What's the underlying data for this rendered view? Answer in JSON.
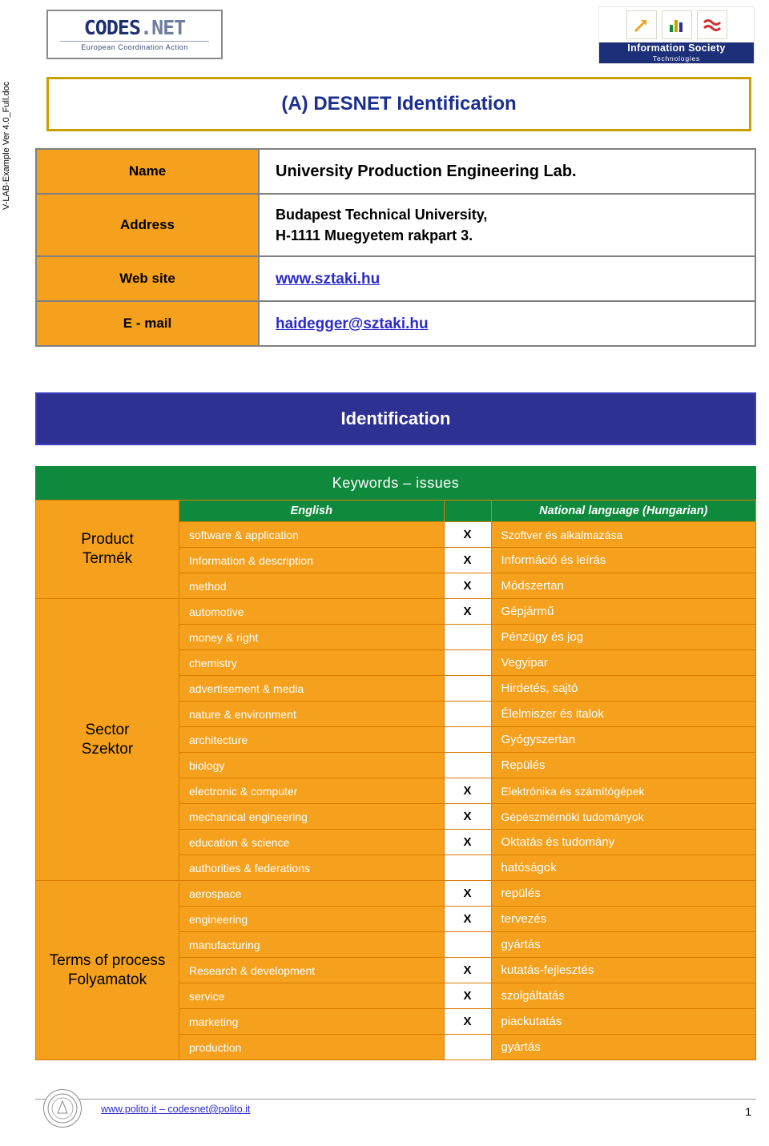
{
  "side_label": "V-LAB-Example Ver 4.0_Full.doc",
  "header": {
    "logo_main": "CODES",
    "logo_main_suffix": ".NET",
    "logo_sub": "European Coordination Action",
    "ist_line1": "Information Society",
    "ist_line2": "Technologies"
  },
  "title": "(A) DESNET Identification",
  "info": {
    "rows": [
      {
        "label": "Name",
        "value": "University Production Engineering Lab.",
        "type": "text"
      },
      {
        "label": "Address",
        "value": "Budapest Technical University,\nH-1111 Muegyetem rakpart 3.",
        "type": "text"
      },
      {
        "label": "Web site",
        "value": "www.sztaki.hu",
        "type": "link"
      },
      {
        "label": "E - mail",
        "value": "haidegger@sztaki.hu",
        "type": "link"
      }
    ]
  },
  "identification_band": "Identification",
  "keywords_band": "Keywords – issues",
  "keywords": {
    "header_english": "English",
    "header_national": "National language (Hungarian)",
    "check_mark": "X",
    "categories": [
      {
        "label_en": "Product",
        "label_hu": "Termék"
      },
      {
        "label_en": "Sector",
        "label_hu": "Szektor"
      },
      {
        "label_en": "Terms of process",
        "label_hu": "Folyamatok"
      }
    ],
    "rows": [
      {
        "group": 0,
        "english": "software & application",
        "checked": true,
        "national": "Szoftver és alkalmazása"
      },
      {
        "group": 0,
        "english": "Information & description",
        "checked": true,
        "national": "Információ és leírás"
      },
      {
        "group": 0,
        "english": "method",
        "checked": true,
        "national": "Módszertan"
      },
      {
        "group": 1,
        "english": "automotive",
        "checked": true,
        "national": "Gépjármű"
      },
      {
        "group": 1,
        "english": "money & right",
        "checked": false,
        "national": "Pénzügy és jog"
      },
      {
        "group": 1,
        "english": "chemistry",
        "checked": false,
        "national": "Vegyipar"
      },
      {
        "group": 1,
        "english": "advertisement & media",
        "checked": false,
        "national": "Hirdetés, sajtó"
      },
      {
        "group": 1,
        "english": "nature & environment",
        "checked": false,
        "national": "Élelmiszer és italok"
      },
      {
        "group": 1,
        "english": "architecture",
        "checked": false,
        "national": "Gyógyszertan"
      },
      {
        "group": 1,
        "english": "biology",
        "checked": false,
        "national": "Repülés"
      },
      {
        "group": 1,
        "english": "electronic & computer",
        "checked": true,
        "national": "Elektrónika és számítógépek"
      },
      {
        "group": 1,
        "english": "mechanical engineering",
        "checked": true,
        "national": "Gépészmérnöki tudományok"
      },
      {
        "group": 1,
        "english": "education & science",
        "checked": true,
        "national": "Oktatás és tudomány"
      },
      {
        "group": 1,
        "english": "authorities & federations",
        "checked": false,
        "national": "hatóságok"
      },
      {
        "group": 2,
        "english": "aerospace",
        "checked": true,
        "national": "repülés"
      },
      {
        "group": 2,
        "english": "engineering",
        "checked": true,
        "national": "tervezés"
      },
      {
        "group": 2,
        "english": "manufacturing",
        "checked": false,
        "national": "gyártás"
      },
      {
        "group": 2,
        "english": "Research & development",
        "checked": true,
        "national": "kutatás-fejlesztés"
      },
      {
        "group": 2,
        "english": "service",
        "checked": true,
        "national": "szolgáltatás"
      },
      {
        "group": 2,
        "english": "marketing",
        "checked": true,
        "national": "piackutatás"
      },
      {
        "group": 2,
        "english": "production",
        "checked": false,
        "national": "gyártás"
      }
    ]
  },
  "footer": {
    "links": "www.polito.it – codesnet@polito.it",
    "page": "1",
    "seal": "POLITECNICO DI TORINO"
  }
}
